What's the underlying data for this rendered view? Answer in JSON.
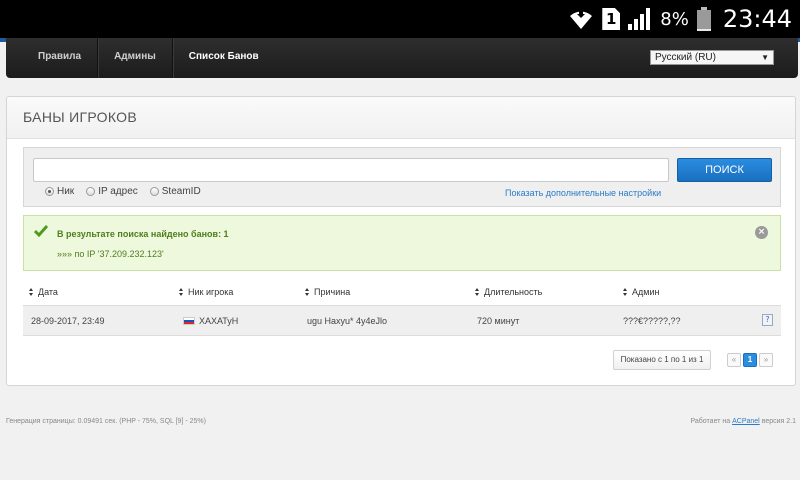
{
  "statusbar": {
    "sim_slot": "1",
    "battery_percent": "8%",
    "battery_level": 0.08,
    "time": "23:44"
  },
  "nav": {
    "items": [
      "Правила",
      "Админы",
      "Список Банов"
    ],
    "active_item": "Список Банов",
    "language": "Русский (RU)"
  },
  "panel": {
    "title": "БАНЫ ИГРОКОВ"
  },
  "search": {
    "input_value": "",
    "button_label": "ПОИСК",
    "options": [
      {
        "label": "Ник",
        "selected": true
      },
      {
        "label": "IP адрес",
        "selected": false
      },
      {
        "label": "SteamID",
        "selected": false
      }
    ],
    "advanced_link": "Показать дополнительные настройки"
  },
  "notice": {
    "line1": "В результате поиска найдено банов: 1",
    "line2": "»»» по IP '37.209.232.123'"
  },
  "table": {
    "columns": [
      "Дата",
      "Ник игрока",
      "Причина",
      "Длительность",
      "Админ"
    ],
    "rows": [
      {
        "date": "28-09-2017, 23:49",
        "nick": "ХАХАТуН",
        "reason": "ugu Haxyu* 4y4eJlo",
        "duration": "720 минут",
        "admin": "???€?????,??"
      }
    ]
  },
  "pagination": {
    "info": "Показано с 1 по 1 из 1",
    "prev": "«",
    "current": "1",
    "next": "»"
  },
  "footer": {
    "generation": "Генерация страницы: 0.09491 сек. (PHP - 75%, SQL [9] - 25%)",
    "powered_prefix": "Работает на",
    "powered_link": "ACPanel",
    "powered_suffix": "версия 2.1"
  },
  "colors": {
    "accent_blue": "#2a8de0",
    "nav_bg": "#1c1c1c",
    "success_bg": "#eef8dc",
    "success_text": "#4f7d1e"
  }
}
